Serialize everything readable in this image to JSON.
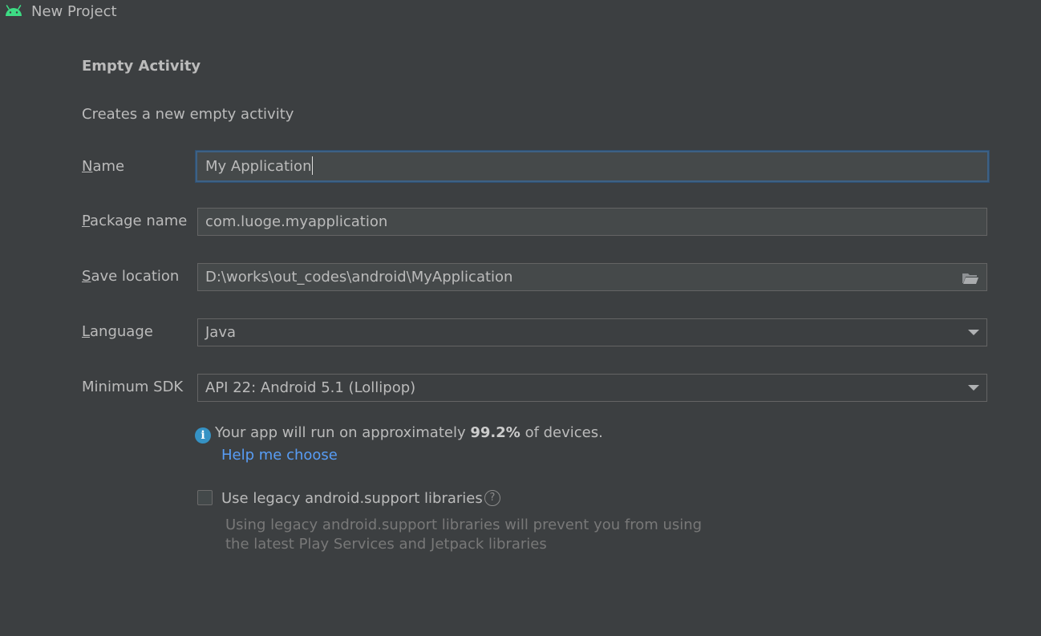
{
  "window": {
    "title": "New Project",
    "icon": "android-icon"
  },
  "template": {
    "heading": "Empty Activity",
    "description": "Creates a new empty activity"
  },
  "fields": {
    "name": {
      "label_mnemonic": "N",
      "label_rest": "ame",
      "value": "My Application"
    },
    "package_name": {
      "label_mnemonic": "P",
      "label_rest": "ackage name",
      "value": "com.luoge.myapplication"
    },
    "save_location": {
      "label_mnemonic": "S",
      "label_rest": "ave location",
      "value": "D:\\works\\out_codes\\android\\MyApplication",
      "browse_icon": "folder-open-icon"
    },
    "language": {
      "label_mnemonic": "L",
      "label_rest": "anguage",
      "value": "Java"
    },
    "minimum_sdk": {
      "label": "Minimum SDK",
      "value": "API 22: Android 5.1 (Lollipop)"
    }
  },
  "info": {
    "icon": "info-icon",
    "prefix": "Your app will run on approximately",
    "percentage": "99.2%",
    "suffix": "of devices.",
    "help_link": "Help me choose"
  },
  "legacy": {
    "checked": false,
    "label": "Use legacy android.support libraries",
    "help_icon_glyph": "?",
    "note_line1": "Using legacy android.support libraries will prevent you from using",
    "note_line2": "the latest Play Services and Jetpack libraries"
  },
  "colors": {
    "background": "#3c3f41",
    "field_background": "#45494a",
    "focus_border": "#3d6185",
    "link": "#589df6",
    "info_icon": "#3592c4",
    "android_green": "#3ddc84"
  }
}
